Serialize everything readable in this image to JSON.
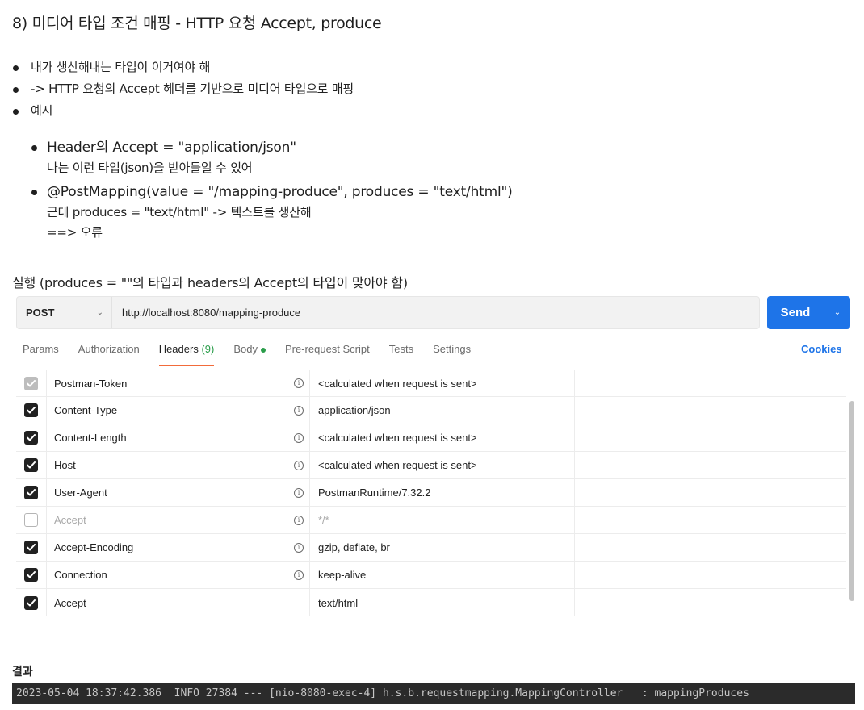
{
  "heading": "8) 미디어 타입 조건 매핑 - HTTP 요청 Accept, produce",
  "bullets": [
    "내가 생산해내는 타입이 이거여야 해",
    "-> HTTP 요청의 Accept 헤더를 기반으로 미디어 타입으로 매핑",
    "예시"
  ],
  "examples": [
    {
      "main": "Header의 Accept = \"application/json\"",
      "desc": [
        "나는 이런 타입(json)을 받아들일 수 있어"
      ]
    },
    {
      "main": "@PostMapping(value = \"/mapping-produce\", produces = \"text/html\")",
      "desc": [
        "근데 produces = \"text/html\" -> 텍스트를 생산해",
        "==> 오류"
      ]
    }
  ],
  "exec_title": "실행 (produces = \"\"의 타입과 headers의 Accept의 타입이 맞아야 함)",
  "request": {
    "method": "POST",
    "url": "http://localhost:8080/mapping-produce",
    "send_label": "Send"
  },
  "tabs": {
    "params": "Params",
    "authorization": "Authorization",
    "headers": "Headers",
    "headers_count": "(9)",
    "body": "Body",
    "prerequest": "Pre-request Script",
    "tests": "Tests",
    "settings": "Settings",
    "cookies": "Cookies"
  },
  "headers": [
    {
      "key": "Postman-Token",
      "value": "<calculated when request is sent>",
      "state": "grey",
      "info": true
    },
    {
      "key": "Content-Type",
      "value": "application/json",
      "state": "on",
      "info": true
    },
    {
      "key": "Content-Length",
      "value": "<calculated when request is sent>",
      "state": "on",
      "info": true
    },
    {
      "key": "Host",
      "value": "<calculated when request is sent>",
      "state": "on",
      "info": true
    },
    {
      "key": "User-Agent",
      "value": "PostmanRuntime/7.32.2",
      "state": "on",
      "info": true
    },
    {
      "key": "Accept",
      "value": "*/*",
      "state": "off",
      "info": true
    },
    {
      "key": "Accept-Encoding",
      "value": "gzip, deflate, br",
      "state": "on",
      "info": true
    },
    {
      "key": "Connection",
      "value": "keep-alive",
      "state": "on",
      "info": true
    },
    {
      "key": "Accept",
      "value": "text/html",
      "state": "on",
      "info": false
    }
  ],
  "result_title": "결과",
  "console_line": "2023-05-04 18:37:42.386  INFO 27384 --- [nio-8080-exec-4] h.s.b.requestmapping.MappingController   : mappingProduces",
  "colors": {
    "send": "#1e74e8",
    "active_tab": "#f26b3a",
    "count": "#2a9d4a",
    "console_bg": "#2b2b2b"
  }
}
